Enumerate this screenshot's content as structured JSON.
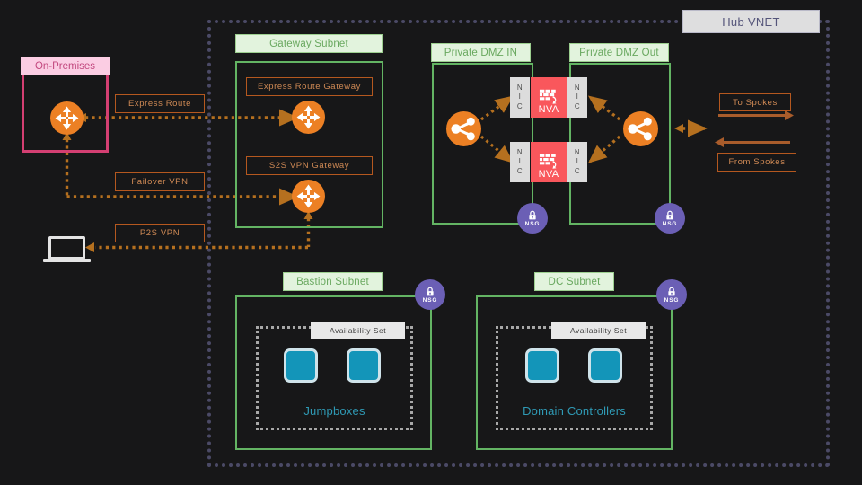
{
  "diagram": {
    "title": "Hub VNET",
    "background": "#171718"
  },
  "vnet": {
    "label": "Hub VNET",
    "border_color": "#4b4a66"
  },
  "onpremises": {
    "label": "On-Premises",
    "border_color": "#d43f72",
    "title_bg": "#fbcde3"
  },
  "connections": {
    "express_route": "Express Route",
    "failover_vpn": "Failover VPN",
    "p2s_vpn": "P2S VPN",
    "to_spokes": "To Spokes",
    "from_spokes": "From Spokes",
    "line_color": "#b5701f"
  },
  "subnets": [
    {
      "id": "gateway",
      "label": "Gateway Subnet"
    },
    {
      "id": "dmz-in",
      "label": "Private DMZ IN"
    },
    {
      "id": "dmz-out",
      "label": "Private DMZ Out"
    },
    {
      "id": "bastion",
      "label": "Bastion Subnet"
    },
    {
      "id": "dc",
      "label": "DC Subnet"
    }
  ],
  "gateway_subnet": {
    "label": "Gateway Subnet",
    "gateways": [
      {
        "label": "Express Route Gateway",
        "icon": "gateway-icon"
      },
      {
        "label": "S2S VPN Gateway",
        "icon": "gateway-icon"
      }
    ]
  },
  "dmz_in": {
    "label": "Private DMZ IN",
    "load_balancer_icon": "load-balancer-icon",
    "nic_label": "NIC",
    "nva_label": "NVA",
    "nsg_label": "NSG",
    "rows": 2
  },
  "dmz_out": {
    "label": "Private DMZ Out",
    "load_balancer_icon": "load-balancer-icon",
    "nic_label": "NIC",
    "nsg_label": "NSG",
    "rows": 2
  },
  "bastion_subnet": {
    "label": "Bastion Subnet",
    "nsg_label": "NSG",
    "availability_set_label": "Availability Set",
    "group_label": "Jumpboxes",
    "vm_count": 2
  },
  "dc_subnet": {
    "label": "DC Subnet",
    "nsg_label": "NSG",
    "availability_set_label": "Availability Set",
    "group_label": "Domain Controllers",
    "vm_count": 2
  },
  "colors": {
    "subnet_green": "#63b463",
    "subnet_title_bg": "#e2f3dd",
    "subnet_title_text": "#69a85f",
    "azure_orange": "#ec8024",
    "nva_red": "#f9575c",
    "nic_gray": "#dcdcdc",
    "nsg_purple": "#6b5fb5",
    "vm_teal": "#1395b9",
    "vnet_purple": "#4b4a66",
    "onprem_pink": "#d43f72"
  }
}
